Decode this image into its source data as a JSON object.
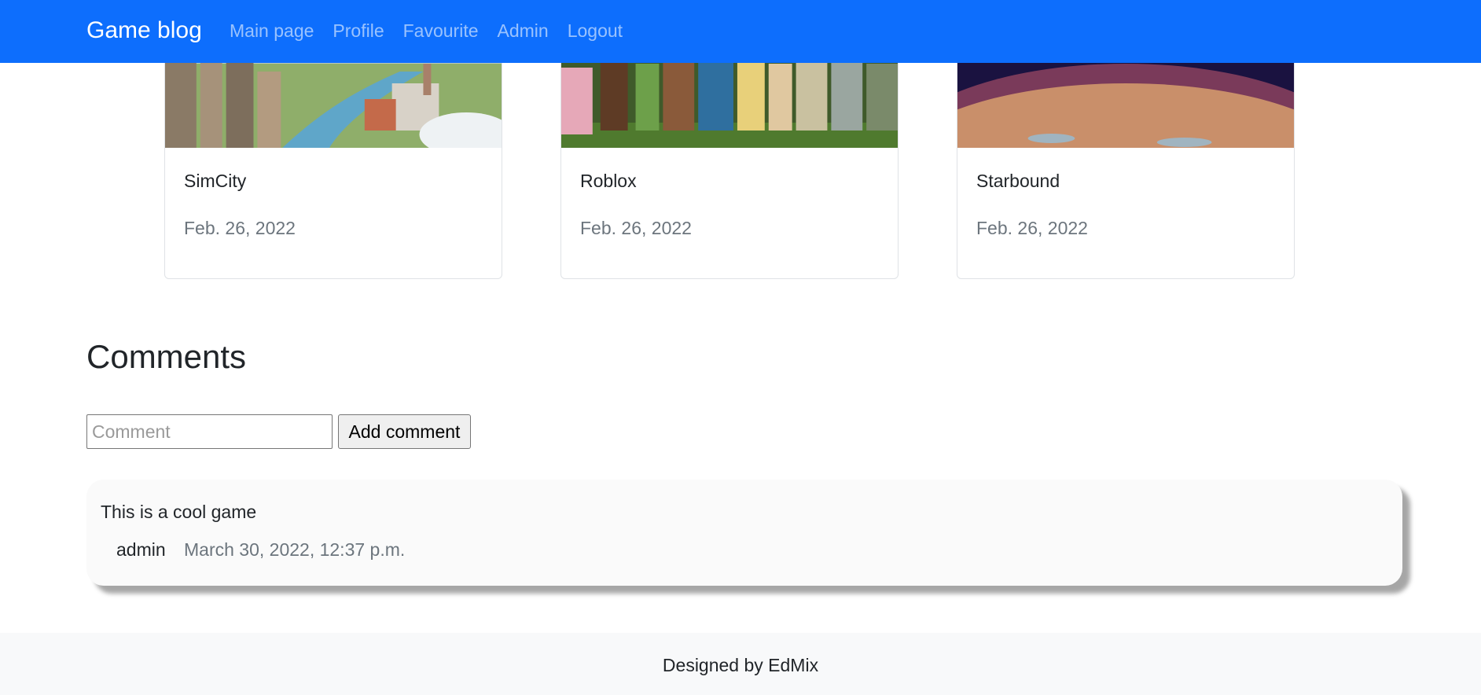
{
  "navbar": {
    "brand": "Game blog",
    "links": [
      "Main page",
      "Profile",
      "Favourite",
      "Admin",
      "Logout"
    ],
    "background": "#0d6efd"
  },
  "cards": [
    {
      "title": "SimCity",
      "date": "Feb. 26, 2022"
    },
    {
      "title": "Roblox",
      "date": "Feb. 26, 2022"
    },
    {
      "title": "Starbound",
      "date": "Feb. 26, 2022"
    }
  ],
  "comments": {
    "heading": "Comments",
    "input_placeholder": "Comment",
    "input_value": "",
    "add_button_label": "Add comment",
    "items": [
      {
        "text": "This is a cool game",
        "author": "admin",
        "date": "March 30, 2022, 12:37 p.m."
      }
    ]
  },
  "footer": {
    "text": "Designed by EdMix"
  }
}
